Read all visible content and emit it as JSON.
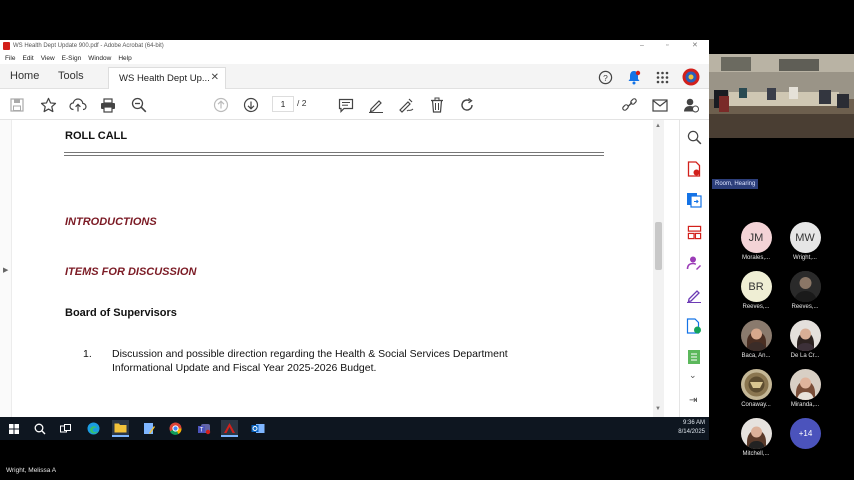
{
  "window": {
    "title": "WS Health Dept Update 900.pdf - Adobe Acrobat (64-bit)",
    "controls": [
      "–",
      "▫",
      "✕"
    ]
  },
  "menu": [
    "File",
    "Edit",
    "View",
    "E-Sign",
    "Window",
    "Help"
  ],
  "tabs": {
    "home": "Home",
    "tools": "Tools",
    "document": "WS Health Dept Up...",
    "close": "✕"
  },
  "toolbar": {
    "current_page": "1",
    "total_pages": "/ 2"
  },
  "document": {
    "roll_call": "ROLL CALL",
    "introductions": "INTRODUCTIONS",
    "items_for_discussion": "ITEMS FOR DISCUSSION",
    "board": "Board of Supervisors",
    "item_number": "1.",
    "item_line1": "Discussion and possible direction regarding the Health & Social Services Department",
    "item_line2": "Informational Update and Fiscal Year 2025-2026 Budget."
  },
  "taskbar": {
    "time": "9:36 AM",
    "date": "8/14/2025"
  },
  "meeting": {
    "room_label": "Room, Hearing",
    "participants": [
      {
        "initials": "JM",
        "name": "Morales,...",
        "color": "#f3d3d6"
      },
      {
        "initials": "MW",
        "name": "Wright,...",
        "color": "#e6e6e6"
      },
      {
        "initials": "BR",
        "name": "Reeves,...",
        "color": "#efeed4"
      },
      {
        "initials": "",
        "name": "Reeves,...",
        "color": "#2a2a2a"
      },
      {
        "initials": "",
        "name": "Baca, An...",
        "color": "#7a5a4a"
      },
      {
        "initials": "",
        "name": "De La Cr...",
        "color": "#d8d2cc"
      },
      {
        "initials": "",
        "name": "Conaway...",
        "color": "#8a7650"
      },
      {
        "initials": "",
        "name": "Miranda,...",
        "color": "#b08a78"
      },
      {
        "initials": "",
        "name": "Mitchell,...",
        "color": "#c8b7a8"
      }
    ],
    "more": "+14",
    "active_speaker": "Wright, Melissa A"
  },
  "colors": {
    "heading_red": "#7b1a24",
    "accent_blue": "#1473e6",
    "acrobat_red": "#d2201b"
  }
}
